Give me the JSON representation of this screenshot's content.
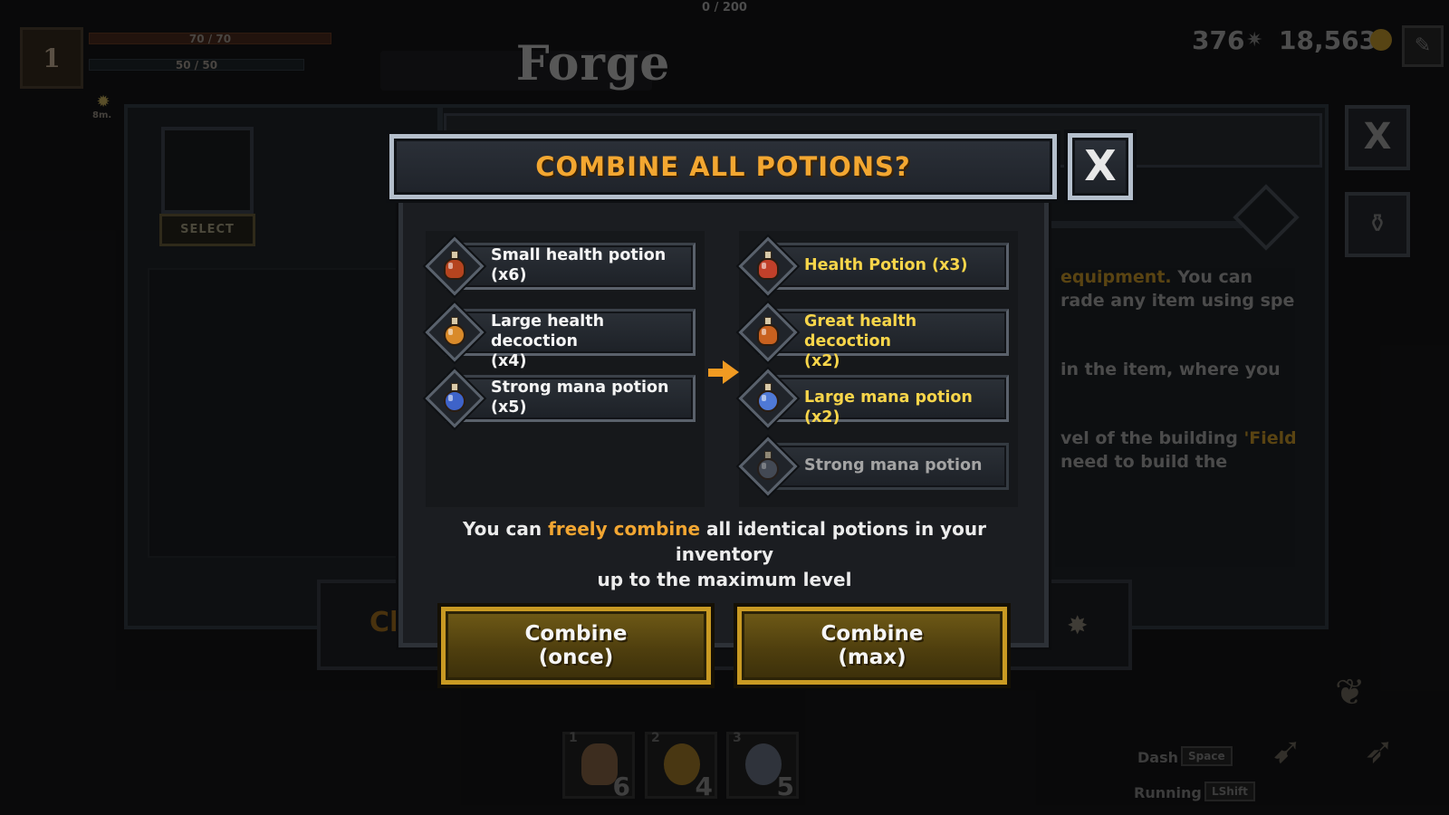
{
  "hud": {
    "xp_counter": "0 / 200",
    "player_level": "1",
    "health": "70 / 70",
    "mana": "50 / 50",
    "buff_timer": "8m.",
    "shards": "376",
    "gold": "18,563"
  },
  "scene": {
    "title": "Forge",
    "select_label": "SELECT",
    "close_glyph": "X",
    "description_lines": [
      {
        "pre": "",
        "gold": "equipment.",
        "post": " You can"
      },
      {
        "pre": "rade any item using special",
        "gold": "",
        "post": ""
      },
      {
        "pre": "in the item, where you",
        "gold": "",
        "post": ""
      },
      {
        "pre": "vel of the building ",
        "gold": "'Field",
        "post": ""
      },
      {
        "pre": "need to build the",
        "gold": "",
        "post": ""
      }
    ],
    "bottom_left_text": "Cl"
  },
  "dialog": {
    "title": "COMBINE ALL POTIONS?",
    "close_glyph": "X",
    "inputs": [
      {
        "line1": "Small health potion",
        "line2": "(x6)",
        "color": "#b5441f"
      },
      {
        "line1": "Large health decoction",
        "line2": "(x4)",
        "color": "#d98a2a"
      },
      {
        "line1": "Strong mana potion",
        "line2": "(x5)",
        "color": "#3e63c9"
      }
    ],
    "outputs": [
      {
        "line1": "Health Potion (x3)",
        "line2": "",
        "color": "#c2402a"
      },
      {
        "line1": "Great health decoction",
        "line2": "(x2)",
        "color": "#c8611f"
      },
      {
        "line1": "Large mana potion (x2)",
        "line2": "",
        "color": "#4f79d6"
      }
    ],
    "disabled_output": {
      "line1": "Strong mana potion",
      "color": "#5b6270"
    },
    "description": {
      "pre": "You can ",
      "highlight": "freely combine",
      "post": " all identical potions in your inventory",
      "line2": "up to the maximum level"
    },
    "buttons": {
      "once_line1": "Combine",
      "once_line2": "(once)",
      "max_line1": "Combine",
      "max_line2": "(max)"
    }
  },
  "hotbar": [
    {
      "slot": "1",
      "count": "6",
      "color": "#4b3826"
    },
    {
      "slot": "2",
      "count": "4",
      "color": "#5a4416"
    },
    {
      "slot": "3",
      "count": "5",
      "color": "#3a3f48"
    }
  ],
  "hints": {
    "dash": "Dash",
    "dash_key": "Space",
    "running": "Running",
    "running_key": "LShift"
  }
}
